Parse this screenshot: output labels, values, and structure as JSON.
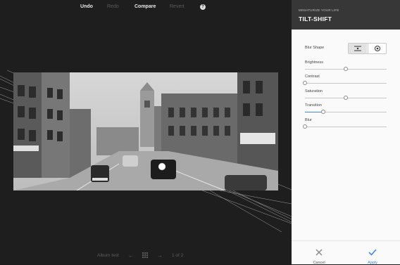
{
  "toolbar": {
    "undo": "Undo",
    "redo": "Redo",
    "compare": "Compare",
    "revert": "Revert",
    "help": "?"
  },
  "bottom_nav": {
    "album": "Album test",
    "page": "1 of 2"
  },
  "panel": {
    "subtitle": "MINIATURIZE YOUR LIFE",
    "title": "TILT-SHIFT",
    "blur_shape_label": "Blur Shape",
    "blur_shape_options": [
      "linear-icon",
      "radial-icon"
    ],
    "blur_shape_selected": "linear-icon",
    "sliders": [
      {
        "label": "Brightness",
        "value": 0.5
      },
      {
        "label": "Contrast",
        "value": 0.0
      },
      {
        "label": "Saturation",
        "value": 0.5
      },
      {
        "label": "Transition",
        "value": 0.22
      },
      {
        "label": "Blur",
        "value": 0.0
      }
    ],
    "cancel": "Cancel",
    "apply": "Apply"
  },
  "colors": {
    "accent": "#4285f4",
    "panel_header": "#373737",
    "editor_bg": "#1e1e1e"
  }
}
